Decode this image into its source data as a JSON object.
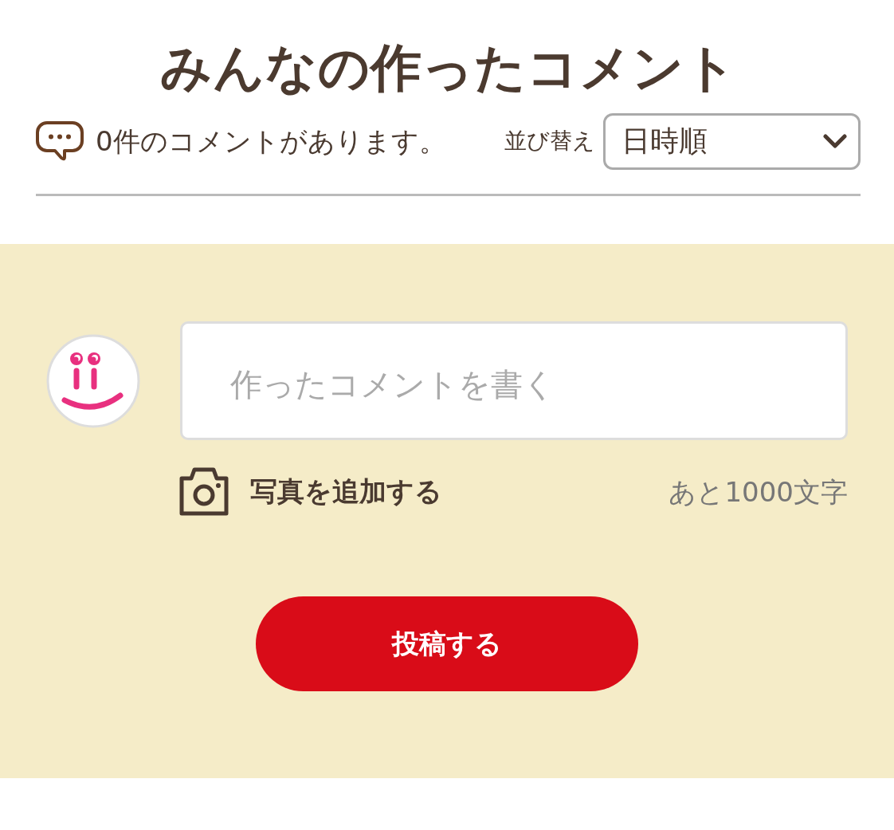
{
  "title": "みんなの作ったコメント",
  "comment_count": {
    "text": "0件のコメントがあります。"
  },
  "sort": {
    "label": "並び替え",
    "value": "日時順"
  },
  "form": {
    "placeholder": "作ったコメントを書く",
    "add_photo": "写真を追加する",
    "remaining": "あと1000文字",
    "submit": "投稿する"
  }
}
